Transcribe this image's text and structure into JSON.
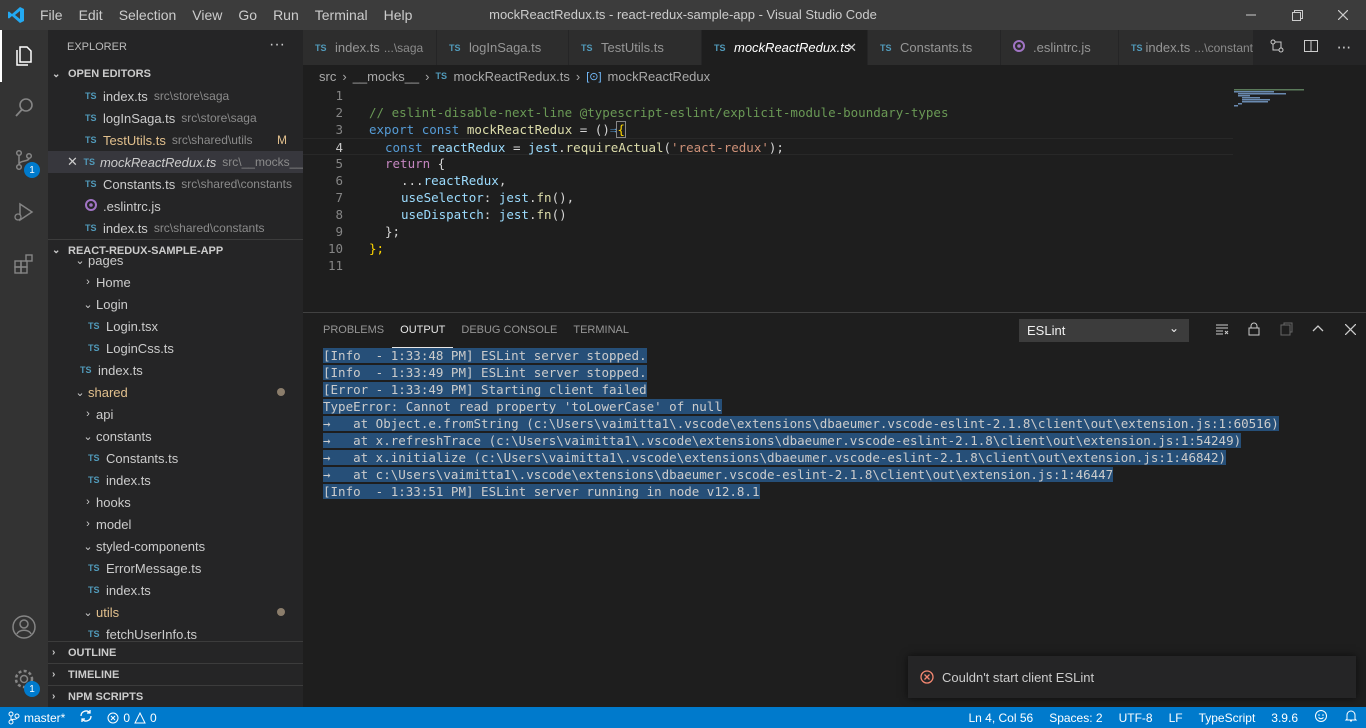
{
  "menu": [
    "File",
    "Edit",
    "Selection",
    "View",
    "Go",
    "Run",
    "Terminal",
    "Help"
  ],
  "window_title": "mockReactRedux.ts - react-redux-sample-app - Visual Studio Code",
  "activity_badges": {
    "scm": "1",
    "settings": "1"
  },
  "explorer": {
    "title": "EXPLORER",
    "open_editors_label": "OPEN EDITORS",
    "open_editors": [
      {
        "type": "TS",
        "name": "index.ts",
        "path": "src\\store\\saga",
        "modified": ""
      },
      {
        "type": "TS",
        "name": "logInSaga.ts",
        "path": "src\\store\\saga",
        "modified": ""
      },
      {
        "type": "TS",
        "name": "TestUtils.ts",
        "path": "src\\shared\\utils",
        "modified": "M"
      },
      {
        "type": "TS",
        "name": "mockReactRedux.ts",
        "path": "src\\__mocks__",
        "modified": ""
      },
      {
        "type": "TS",
        "name": "Constants.ts",
        "path": "src\\shared\\constants",
        "modified": ""
      },
      {
        "type": "ESL",
        "name": ".eslintrc.js",
        "path": "",
        "modified": ""
      },
      {
        "type": "TS",
        "name": "index.ts",
        "path": "src\\shared\\constants",
        "modified": ""
      }
    ],
    "project_label": "REACT-REDUX-SAMPLE-APP",
    "tree": {
      "pages": "pages",
      "home": "Home",
      "login": "Login",
      "login_tsx": "Login.tsx",
      "login_css": "LoginCss.ts",
      "index_pages": "index.ts",
      "shared": "shared",
      "api": "api",
      "constants": "constants",
      "constants_ts": "Constants.ts",
      "constants_index": "index.ts",
      "hooks": "hooks",
      "model": "model",
      "styled_components": "styled-components",
      "error_message": "ErrorMessage.ts",
      "styled_index": "index.ts",
      "utils": "utils",
      "fetch_user": "fetchUserInfo.ts"
    },
    "outline_label": "OUTLINE",
    "timeline_label": "TIMELINE",
    "npm_label": "NPM SCRIPTS"
  },
  "tabs": [
    {
      "type": "TS",
      "name": "index.ts",
      "path": "...\\saga",
      "active": false
    },
    {
      "type": "TS",
      "name": "logInSaga.ts",
      "path": "",
      "active": false
    },
    {
      "type": "TS",
      "name": "TestUtils.ts",
      "path": "",
      "active": false
    },
    {
      "type": "TS",
      "name": "mockReactRedux.ts",
      "path": "",
      "active": true
    },
    {
      "type": "TS",
      "name": "Constants.ts",
      "path": "",
      "active": false
    },
    {
      "type": "ESL",
      "name": ".eslintrc.js",
      "path": "",
      "active": false
    },
    {
      "type": "TS",
      "name": "index.ts",
      "path": "...\\constant",
      "active": false
    }
  ],
  "breadcrumbs": {
    "src": "src",
    "mocks": "__mocks__",
    "file": "mockReactRedux.ts",
    "symbol": "mockReactRedux"
  },
  "code": {
    "line_numbers": [
      "1",
      "2",
      "3",
      "4",
      "5",
      "6",
      "7",
      "8",
      "9",
      "10",
      "11"
    ],
    "l2": "// eslint-disable-next-line @typescript-eslint/explicit-module-boundary-types",
    "l3_kw1": "export",
    "l3_kw2": "const",
    "l3_name": "mockReactRedux",
    "l3_rest": " = ()",
    "l3_arrow": "⇒",
    "l3_brace": "{",
    "l4_kw": "const",
    "l4_var": "reactRedux",
    "l4_eq": " = ",
    "l4_obj": "jest",
    "l4_fn": "requireActual",
    "l4_str": "'react-redux'",
    "l4_end": ");",
    "l5_kw": "return",
    "l5_brace": " {",
    "l6_spread": "...",
    "l6_var": "reactRedux",
    "l6_end": ",",
    "l7_prop": "useSelector",
    "l7_obj": "jest",
    "l7_fn": "fn",
    "l7_end": "(),",
    "l8_prop": "useDispatch",
    "l8_obj": "jest",
    "l8_fn": "fn",
    "l8_end": "()",
    "l9": "};",
    "l10": "};"
  },
  "panel": {
    "tabs": [
      "PROBLEMS",
      "OUTPUT",
      "DEBUG CONSOLE",
      "TERMINAL"
    ],
    "active_tab": "OUTPUT",
    "channel": "ESLint",
    "output_lines": [
      "[Info  - 1:33:48 PM] ESLint server stopped.",
      "[Info  - 1:33:49 PM] ESLint server stopped.",
      "[Error - 1:33:49 PM] Starting client failed",
      "TypeError: Cannot read property 'toLowerCase' of null",
      "→   at Object.e.fromString (c:\\Users\\vaimitta1\\.vscode\\extensions\\dbaeumer.vscode-eslint-2.1.8\\client\\out\\extension.js:1:60516)",
      "→   at x.refreshTrace (c:\\Users\\vaimitta1\\.vscode\\extensions\\dbaeumer.vscode-eslint-2.1.8\\client\\out\\extension.js:1:54249)",
      "→   at x.initialize (c:\\Users\\vaimitta1\\.vscode\\extensions\\dbaeumer.vscode-eslint-2.1.8\\client\\out\\extension.js:1:46842)",
      "→   at c:\\Users\\vaimitta1\\.vscode\\extensions\\dbaeumer.vscode-eslint-2.1.8\\client\\out\\extension.js:1:46447",
      "[Info  - 1:33:51 PM] ESLint server running in node v12.8.1"
    ]
  },
  "notification": {
    "text": "Couldn't start client ESLint"
  },
  "status": {
    "branch": "master*",
    "errors": "0",
    "warnings": "0",
    "position": "Ln 4, Col 56",
    "spaces": "Spaces: 2",
    "encoding": "UTF-8",
    "eol": "LF",
    "language": "TypeScript",
    "ts_version": "3.9.6"
  },
  "colors": {
    "accent": "#007acc",
    "error": "#f48771"
  }
}
